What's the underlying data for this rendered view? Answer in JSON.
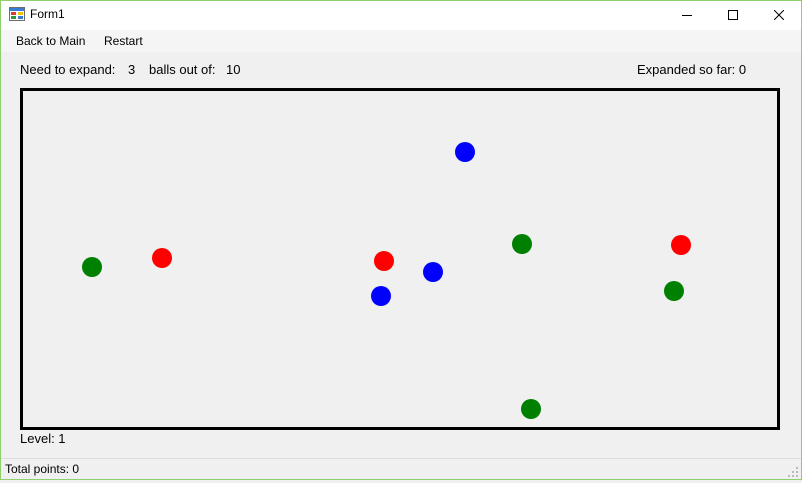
{
  "window": {
    "title": "Form1",
    "icon": "app-icon",
    "minimize_icon": "minimize-icon",
    "maximize_icon": "maximize-icon",
    "close_icon": "close-icon"
  },
  "menu": {
    "items": [
      {
        "label": "Back to Main"
      },
      {
        "label": "Restart"
      }
    ]
  },
  "header": {
    "need_label": "Need to expand:",
    "need_value": "3",
    "total_label": "balls out of:",
    "total_value": "10",
    "expanded": "Expanded so far: 0"
  },
  "game": {
    "balls": [
      {
        "fill": "#0000ff"
      },
      {
        "fill": "#008000"
      },
      {
        "fill": "#ff0000"
      },
      {
        "fill": "#008000"
      },
      {
        "fill": "#ff0000"
      },
      {
        "fill": "#ff0000"
      },
      {
        "fill": "#0000ff"
      },
      {
        "fill": "#0000ff"
      },
      {
        "fill": "#008000"
      },
      {
        "fill": "#008000"
      }
    ]
  },
  "footer": {
    "level": "Level: 1"
  },
  "statusbar": {
    "text": "Total points: 0",
    "grip_icon": "resize-grip-icon"
  },
  "colors": {
    "window_border": "#8dd06c",
    "title_bar": "#ffffff",
    "menu_background": "#f5f5f5",
    "form_background": "#f0f0f0",
    "panel_border": "#000000"
  }
}
